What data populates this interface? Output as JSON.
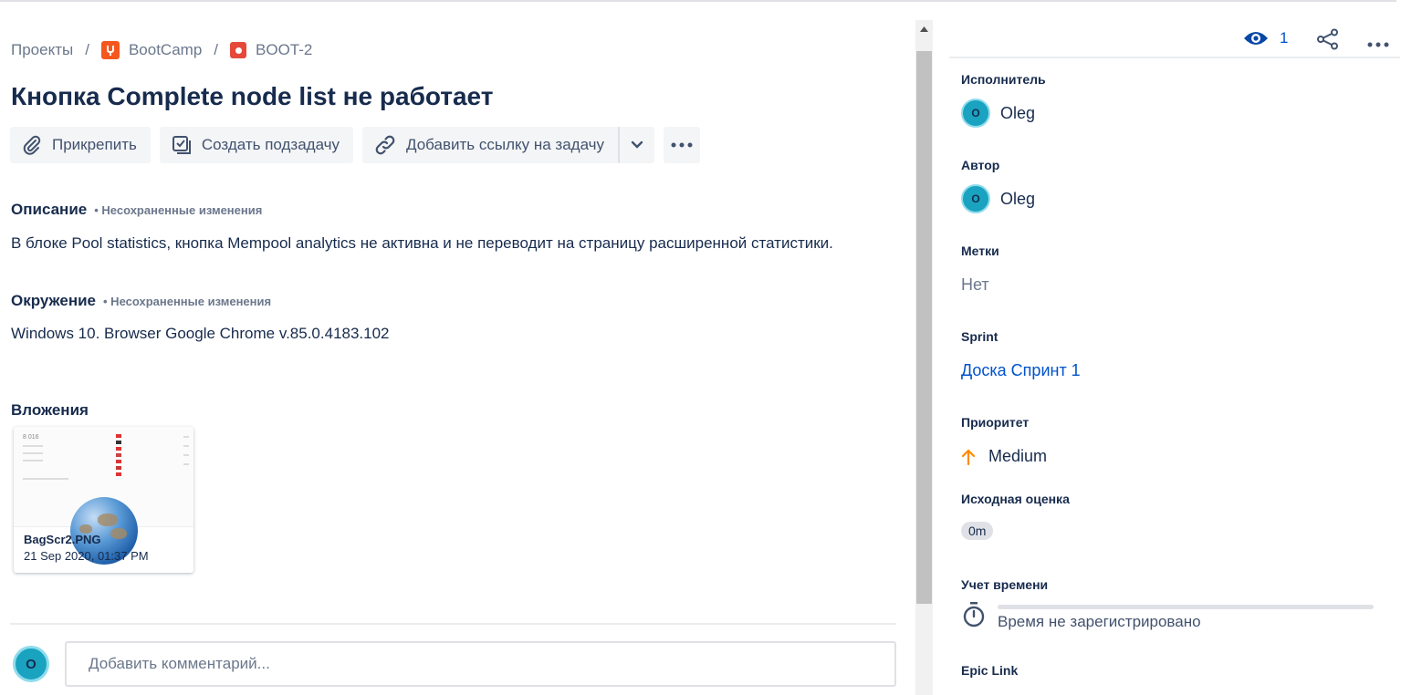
{
  "breadcrumb": {
    "projects": "Проекты",
    "sep": "/",
    "project": "BootCamp",
    "issue_key": "BOOT-2"
  },
  "issue": {
    "title": "Кнопка Complete node list не работает"
  },
  "toolbar": {
    "attach": "Прикрепить",
    "create_subtask": "Создать подзадачу",
    "link_issue": "Добавить ссылку на задачу"
  },
  "description": {
    "heading": "Описание",
    "unsaved": "• Несохраненные изменения",
    "text": "В блоке Pool statistics, кнопка Mempool analytics не активна и не переводит на страницу расширенной статистики."
  },
  "environment": {
    "heading": "Окружение",
    "unsaved": "• Несохраненные изменения",
    "text": "Windows 10. Browser Google Chrome v.85.0.4183.102"
  },
  "attachments": {
    "heading": "Вложения",
    "items": [
      {
        "filename": "BagScr2.PNG",
        "date": "21 Sep 2020, 01:37 PM",
        "thumb_number": "8 016"
      }
    ]
  },
  "comment": {
    "avatar_initial": "O",
    "placeholder": "Добавить комментарий..."
  },
  "sidebar": {
    "watchers_count": "1",
    "assignee": {
      "label": "Исполнитель",
      "initial": "O",
      "name": "Oleg"
    },
    "reporter": {
      "label": "Автор",
      "initial": "O",
      "name": "Oleg"
    },
    "labels": {
      "label": "Метки",
      "value": "Нет"
    },
    "sprint": {
      "label": "Sprint",
      "value": "Доска Спринт 1"
    },
    "priority": {
      "label": "Приоритет",
      "value": "Medium"
    },
    "estimate": {
      "label": "Исходная оценка",
      "value": "0m"
    },
    "time_tracking": {
      "label": "Учет времени",
      "value": "Время не зарегистрировано"
    },
    "epic_link": {
      "label": "Epic Link"
    }
  },
  "colors": {
    "text_primary": "#172b4d",
    "text_secondary": "#6b778c",
    "link": "#0052cc",
    "avatar": "#1aa3c0",
    "priority_medium": "#ff8b00",
    "project_icon": "#f4581e",
    "issue_icon": "#e5493a"
  }
}
